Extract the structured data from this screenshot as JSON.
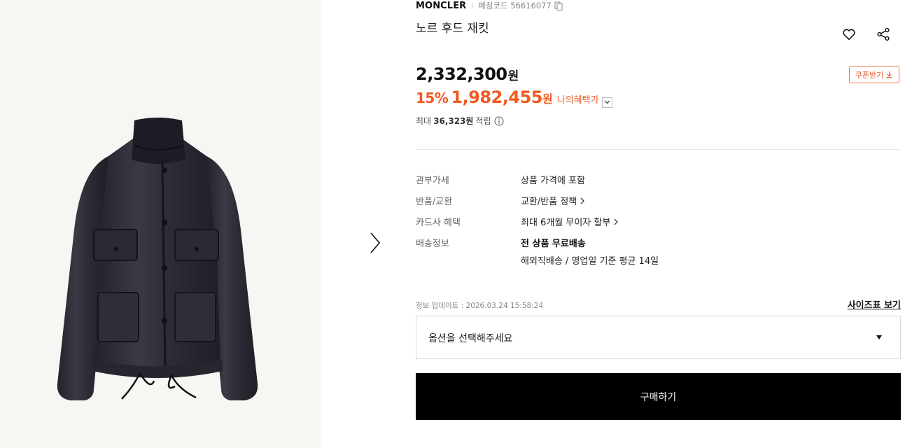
{
  "product": {
    "brand": "MONCLER",
    "code_label": "페칭코드 56616077",
    "title": "노르 후드 재킷"
  },
  "pricing": {
    "price": "2,332,300",
    "price_unit": "원",
    "discount_pct": "15%",
    "sale_price": "1,982,455",
    "sale_unit": "원",
    "benefit_label": "나의혜택가",
    "coupon_label": "쿠폰받기",
    "points_prefix": "최대",
    "points_amount": "36,323원",
    "points_suffix": "적립"
  },
  "details": [
    {
      "label": "관부가세",
      "value": "상품 가격에 포함"
    },
    {
      "label": "반품/교환",
      "value": "교환/반품 정책"
    },
    {
      "label": "카드사 혜택",
      "value": "최대 6개월 무이자 할부"
    },
    {
      "label": "배송정보",
      "value": "전 상품 무료배송",
      "value2": "해외직배송 / 영업일 기준 평균 14일"
    }
  ],
  "updated": "정보 업데이트 : 2026.03.24 15:58:24",
  "size_chart_label": "사이즈표 보기",
  "option_placeholder": "옵션을 선택해주세요",
  "buy_label": "구매하기",
  "colors": {
    "accent": "#ef5a22",
    "button": "#000000"
  },
  "icons": [
    "copy-icon",
    "heart-icon",
    "share-icon",
    "download-icon",
    "chevron-down-icon",
    "info-icon",
    "chevron-right-icon",
    "next-arrow-icon",
    "caret-down-icon"
  ]
}
